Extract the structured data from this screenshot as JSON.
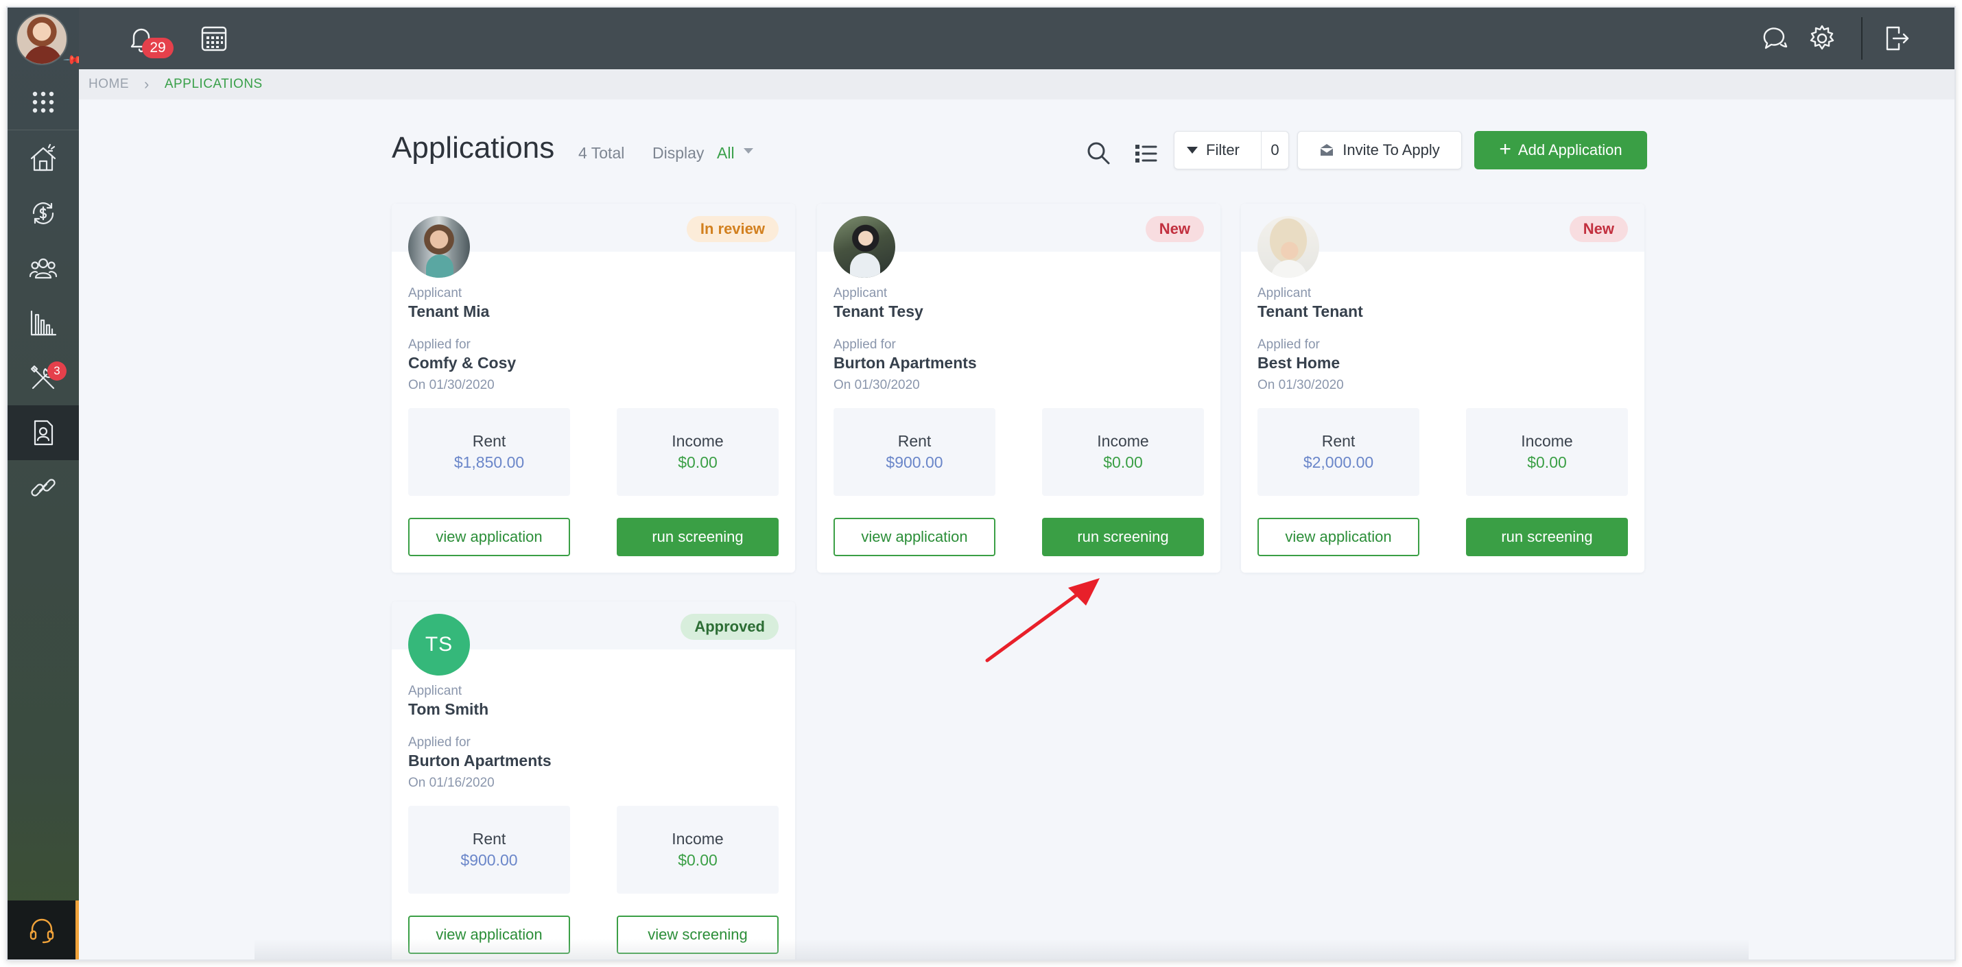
{
  "topbar": {
    "notification_count": "29"
  },
  "sidebar": {
    "items": [
      {
        "icon": "apps-grid-icon"
      },
      {
        "icon": "house-icon"
      },
      {
        "icon": "money-cycle-icon"
      },
      {
        "icon": "people-icon"
      },
      {
        "icon": "bar-chart-icon"
      },
      {
        "icon": "tools-icon",
        "badge": "3"
      },
      {
        "icon": "applicant-doc-icon",
        "active": true
      },
      {
        "icon": "link-icon"
      }
    ],
    "support_icon": "headset-icon"
  },
  "breadcrumb": {
    "home": "HOME",
    "current": "APPLICATIONS"
  },
  "header": {
    "title": "Applications",
    "total": "4 Total",
    "display_label": "Display",
    "display_value": "All",
    "filter_label": "Filter",
    "filter_count": "0",
    "invite_label": "Invite To Apply",
    "add_label": "Add Application"
  },
  "cards": [
    {
      "status": "In review",
      "applicant_label": "Applicant",
      "applicant": "Tenant Mia",
      "applied_for_label": "Applied for",
      "property": "Comfy & Cosy",
      "date": "On 01/30/2020",
      "rent_label": "Rent",
      "rent": "$1,850.00",
      "income_label": "Income",
      "income": "$0.00",
      "view_label": "view application",
      "action_label": "run screening"
    },
    {
      "status": "New",
      "applicant_label": "Applicant",
      "applicant": "Tenant Tesy",
      "applied_for_label": "Applied for",
      "property": "Burton Apartments",
      "date": "On 01/30/2020",
      "rent_label": "Rent",
      "rent": "$900.00",
      "income_label": "Income",
      "income": "$0.00",
      "view_label": "view application",
      "action_label": "run screening"
    },
    {
      "status": "New",
      "applicant_label": "Applicant",
      "applicant": "Tenant Tenant",
      "applied_for_label": "Applied for",
      "property": "Best Home",
      "date": "On 01/30/2020",
      "rent_label": "Rent",
      "rent": "$2,000.00",
      "income_label": "Income",
      "income": "$0.00",
      "view_label": "view application",
      "action_label": "run screening"
    },
    {
      "status": "Approved",
      "initials": "TS",
      "applicant_label": "Applicant",
      "applicant": "Tom Smith",
      "applied_for_label": "Applied for",
      "property": "Burton Apartments",
      "date": "On 01/16/2020",
      "rent_label": "Rent",
      "rent": "$900.00",
      "income_label": "Income",
      "income": "$0.00",
      "view_label": "view application",
      "action_label": "view screening"
    }
  ],
  "colors": {
    "accent_green": "#3a9f45",
    "sidebar": "#3f4a50",
    "topbar": "#434c52",
    "badge_red": "#e5404b",
    "annotation_arrow": "#e8202a"
  }
}
